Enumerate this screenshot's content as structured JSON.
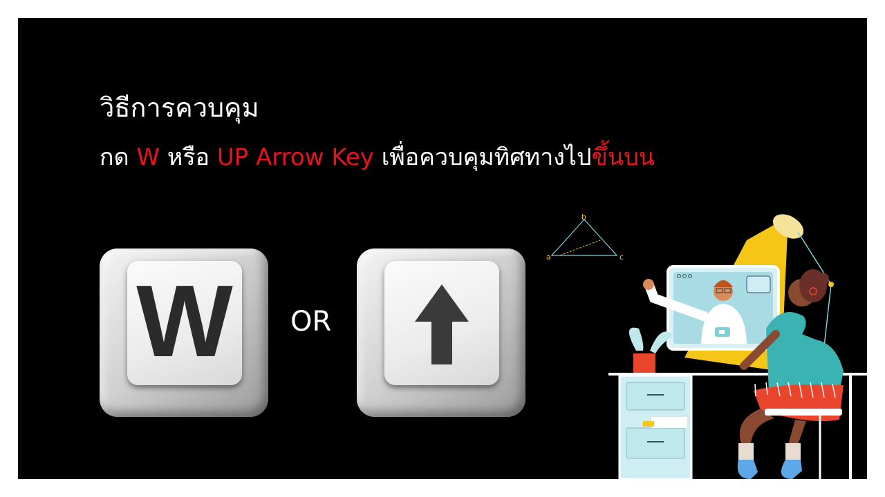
{
  "slide": {
    "heading": "วิธีการควบคุม",
    "instruction": {
      "prefix": "กด ",
      "key_w": "W",
      "middle": " หรือ ",
      "key_up": "UP Arrow Key",
      "suffix": " เพื่อควบคุมทิศทางไป",
      "direction": "ขึ้นบน"
    },
    "key_w_label": "W",
    "key_up_icon": "up-arrow-icon",
    "or_label": "OR",
    "illustration": {
      "triangle_labels": [
        "a",
        "b",
        "c"
      ],
      "icons": [
        "video-call-icon",
        "desk-lamp-icon",
        "triangle-diagram-icon"
      ]
    }
  },
  "colors": {
    "background": "#000000",
    "frame": "#ffffff",
    "text": "#ffffff",
    "accent": "#e8141c"
  }
}
